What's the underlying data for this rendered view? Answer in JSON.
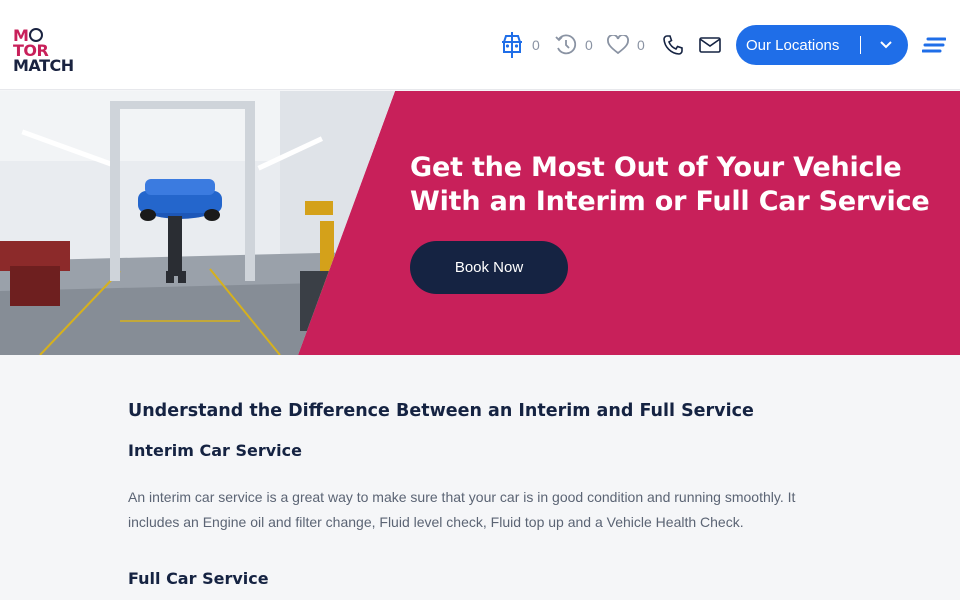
{
  "logo": {
    "line1_pre": "M",
    "line1_post": "TOR",
    "line2": "MATCH"
  },
  "header": {
    "compare_count": "0",
    "history_count": "0",
    "favorites_count": "0",
    "location_button_label": "Our Locations"
  },
  "icons": {
    "compare": "car-compare-icon",
    "history": "history-icon",
    "favorites": "heart-icon",
    "phone": "phone-icon",
    "email": "mail-icon",
    "chevron": "chevron-down-icon",
    "menu": "hamburger-menu-icon"
  },
  "hero": {
    "title": "Get the Most Out of Your Vehicle With an Interim or Full Car Service",
    "button_label": "Book Now"
  },
  "section": {
    "heading": "Understand the Difference Between an Interim and Full Service",
    "interim_heading": "Interim Car Service",
    "interim_text": "An interim car service is a great way to make sure that your car is in good condition and running smoothly. It includes an Engine oil and filter change, Fluid level check, Fluid top up and a Vehicle Health Check.",
    "full_heading": "Full Car Service"
  },
  "colors": {
    "brand_pink": "#c8205a",
    "navy": "#152342",
    "accent_blue": "#1f6ee8",
    "page_bg": "#f5f6f8"
  }
}
